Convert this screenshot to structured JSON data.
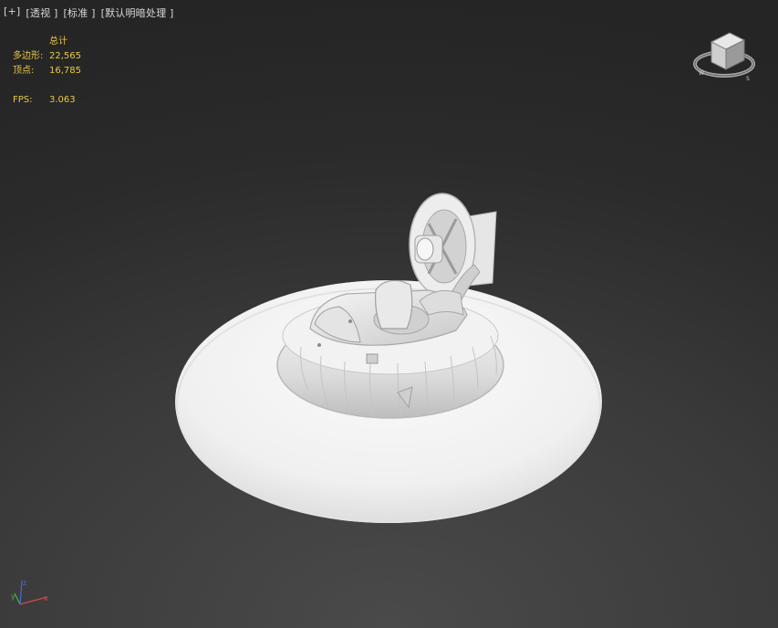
{
  "viewport": {
    "labels": [
      "[+]",
      "[透视 ]",
      "[标准 ]",
      "[默认明暗处理 ]"
    ]
  },
  "stats": {
    "header": "总计",
    "polygons_label": "多边形:",
    "polygons_value": "22,565",
    "vertices_label": "顶点:",
    "vertices_value": "16,785",
    "fps_label": "FPS:",
    "fps_value": "3.063"
  },
  "axis_labels": {
    "x": "x",
    "y": "y",
    "z": "z"
  },
  "colors": {
    "stats_text": "#e8c84a",
    "axis_x": "#d24a4a",
    "axis_y": "#4ab34a",
    "axis_z": "#4a6ad2"
  }
}
